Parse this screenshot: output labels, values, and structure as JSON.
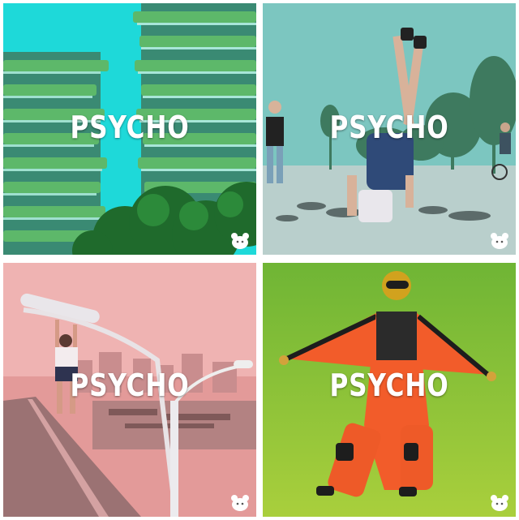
{
  "tiles": [
    {
      "caption": "PSYCHO",
      "scene": "vertical forest towers with overlaid cyan tint",
      "tint": "#19d6d6",
      "badge_icon": "bear-icon"
    },
    {
      "caption": "PSYCHO",
      "scene": "person doing a handstand on a gravel road",
      "tint": "#6fbfb4",
      "badge_icon": "bear-icon"
    },
    {
      "caption": "PSYCHO",
      "scene": "man hanging from a street lamp over a highway",
      "tint": "#e7a3a3",
      "badge_icon": "bear-icon"
    },
    {
      "caption": "PSYCHO",
      "scene": "skydiver in an orange wingsuit",
      "tint": "#8fc43a",
      "badge_icon": "bear-icon"
    }
  ]
}
